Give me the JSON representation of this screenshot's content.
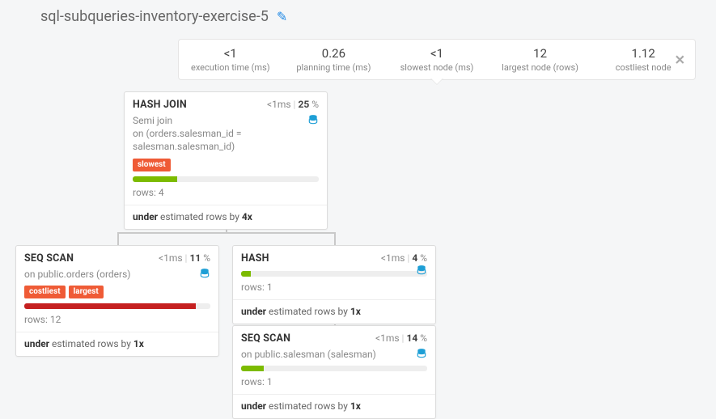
{
  "title": "sql-subqueries-inventory-exercise-5",
  "metrics": [
    {
      "value": "<1",
      "label": "execution time (ms)"
    },
    {
      "value": "0.26",
      "label": "planning time (ms)"
    },
    {
      "value": "<1",
      "label": "slowest node (ms)"
    },
    {
      "value": "12",
      "label": "largest node (rows)"
    },
    {
      "value": "1.12",
      "label": "costliest node"
    }
  ],
  "nodes": {
    "hashjoin": {
      "name": "HASH JOIN",
      "time": "<1ms",
      "pct": "25",
      "sub_prefix": "Semi",
      "sub_word": "join",
      "sub_on": "on (orders.salesman_id = salesman.salesman_id)",
      "tags": [
        "slowest"
      ],
      "bar_color": "green",
      "bar_pct": 24,
      "rows": "rows: 4",
      "est_bold1": "under",
      "est_mid": " estimated rows by ",
      "est_bold2": "4x"
    },
    "seqscan1": {
      "name": "SEQ SCAN",
      "time": "<1ms",
      "pct": "11",
      "sub_on": "on public.orders (orders)",
      "tags": [
        "costliest",
        "largest"
      ],
      "bar_color": "red",
      "bar_pct": 92,
      "rows": "rows: 12",
      "est_bold1": "under",
      "est_mid": " estimated rows by ",
      "est_bold2": "1x"
    },
    "hash": {
      "name": "HASH",
      "time": "<1ms",
      "pct": "4",
      "bar_color": "green",
      "bar_pct": 5,
      "rows": "rows: 1",
      "est_bold1": "under",
      "est_mid": " estimated rows by ",
      "est_bold2": "1x"
    },
    "seqscan2": {
      "name": "SEQ SCAN",
      "time": "<1ms",
      "pct": "14",
      "sub_on": "on public.salesman (salesman)",
      "bar_color": "green",
      "bar_pct": 12,
      "rows": "rows: 1",
      "est_bold1": "under",
      "est_mid": " estimated rows by ",
      "est_bold2": "1x"
    }
  }
}
